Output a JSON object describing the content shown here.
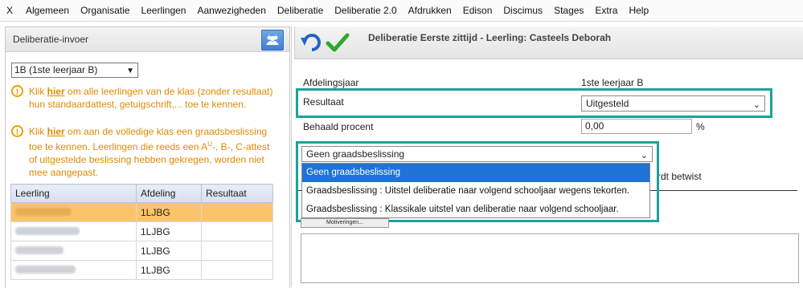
{
  "menubar": {
    "items": [
      "X",
      "Algemeen",
      "Organisatie",
      "Leerlingen",
      "Aanwezigheden",
      "Deliberatie",
      "Deliberatie 2.0",
      "Afdrukken",
      "Edison",
      "Discimus",
      "Stages",
      "Extra",
      "Help"
    ]
  },
  "left_panel": {
    "title": "Deliberatie-invoer",
    "class_select": "1B (1ste leerjaar B)",
    "note1": {
      "pre": "Klik ",
      "link": "hier",
      "post": " om alle leerlingen van de klas (zonder resultaat) hun standaardattest, getuigschrift,... toe te kennen."
    },
    "note2": {
      "pre": "Klik ",
      "link": "hier",
      "post": " om aan de volledige klas een graadsbeslissing toe te kennen. Leerlingen die reeds een A",
      "sup": "U",
      "post2": "-, B-, C-attest of uitgestelde beslissing hebben gekregen, worden niet mee aangepast."
    },
    "table": {
      "headers": [
        "Leerling",
        "Afdeling",
        "Resultaat"
      ],
      "rows": [
        {
          "afdeling": "1LJBG",
          "resultaat": ""
        },
        {
          "afdeling": "1LJBG",
          "resultaat": ""
        },
        {
          "afdeling": "1LJBG",
          "resultaat": ""
        },
        {
          "afdeling": "1LJBG",
          "resultaat": ""
        }
      ]
    }
  },
  "right_panel": {
    "title": "Deliberatie Eerste zittijd - Leerling: Casteels Deborah",
    "afdelingsjaar_label": "Afdelingsjaar",
    "afdelingsjaar_value": "1ste leerjaar B",
    "resultaat_label": "Resultaat",
    "resultaat_value": "Uitgesteld",
    "procent_label": "Behaald procent",
    "procent_value": "0,00",
    "procent_unit": "%",
    "graad_select": "Geen graadsbeslissing",
    "graad_options": [
      "Geen graadsbeslissing",
      "Graadsbeslissing : Uitstel deliberatie naar volgend schooljaar wegens tekorten.",
      "Graadsbeslissing : Klassikale uitstel van deliberatie naar volgend schooljaar."
    ],
    "partial_text": "rdt betwist",
    "small_button": "Motiveringen..."
  },
  "colors": {
    "highlight": "#1aa39b",
    "selected_row": "#fcc46a",
    "dropdown_active": "#1e73d4",
    "note": "#e08a00"
  }
}
